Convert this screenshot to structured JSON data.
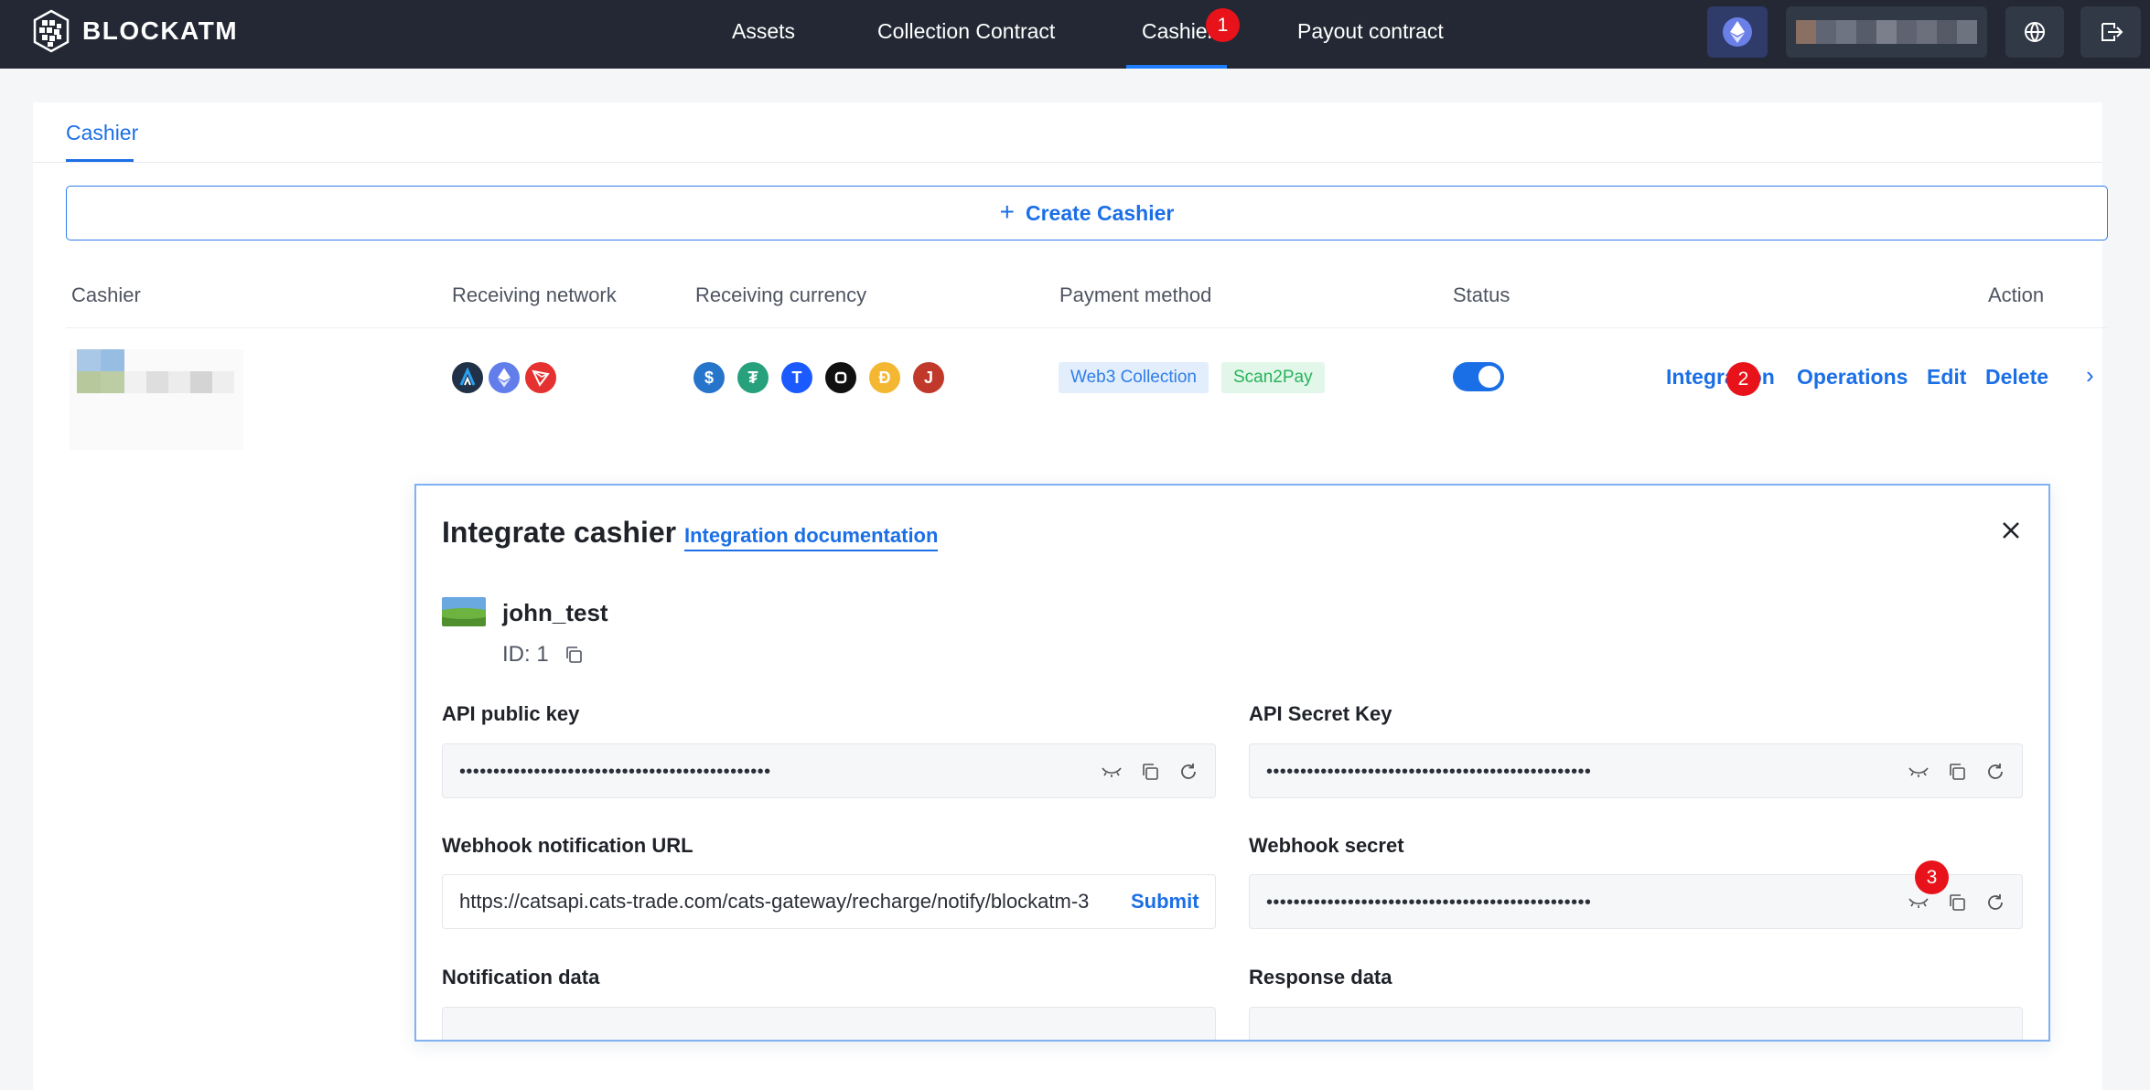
{
  "app": {
    "logo_text": "BLOCKATM",
    "nav": [
      {
        "label": "Assets"
      },
      {
        "label": "Collection Contract"
      },
      {
        "label": "Cashier"
      },
      {
        "label": "Payout contract"
      }
    ],
    "accent_color": "#1b6fe6"
  },
  "annotations": [
    "1",
    "2",
    "3"
  ],
  "page": {
    "tab_label": "Cashier",
    "create_label": "Create Cashier",
    "columns": [
      "Cashier",
      "Receiving network",
      "Receiving currency",
      "Payment method",
      "Status",
      "Action"
    ],
    "row": {
      "networks": [
        "arbitrum-icon",
        "ethereum-icon",
        "tron-icon"
      ],
      "currencies": [
        "usdc-icon",
        "usdt-icon",
        "tusd-icon",
        "custom-coin-icon",
        "dai-icon",
        "j-coin-icon"
      ],
      "payment_methods": [
        "Web3 Collection",
        "Scan2Pay"
      ],
      "status_on": true,
      "actions": [
        "Integration",
        "Operations",
        "Edit",
        "Delete"
      ]
    }
  },
  "modal": {
    "title": "Integrate cashier",
    "doc_link": "Integration documentation",
    "cashier_name": "john_test",
    "cashier_id": "ID: 1",
    "api_public_key_label": "API public key",
    "api_public_key_value": "••••••••••••••••••••••••••••••••••••••••••••••",
    "api_secret_key_label": "API Secret Key",
    "api_secret_key_value": "••••••••••••••••••••••••••••••••••••••••••••••••",
    "webhook_url_label": "Webhook notification URL",
    "webhook_url_value": "https://catsapi.cats-trade.com/cats-gateway/recharge/notify/blockatm-3",
    "webhook_submit": "Submit",
    "webhook_secret_label": "Webhook secret",
    "webhook_secret_value": "••••••••••••••••••••••••••••••••••••••••••••••••",
    "notification_data_label": "Notification data",
    "response_data_label": "Response data"
  }
}
